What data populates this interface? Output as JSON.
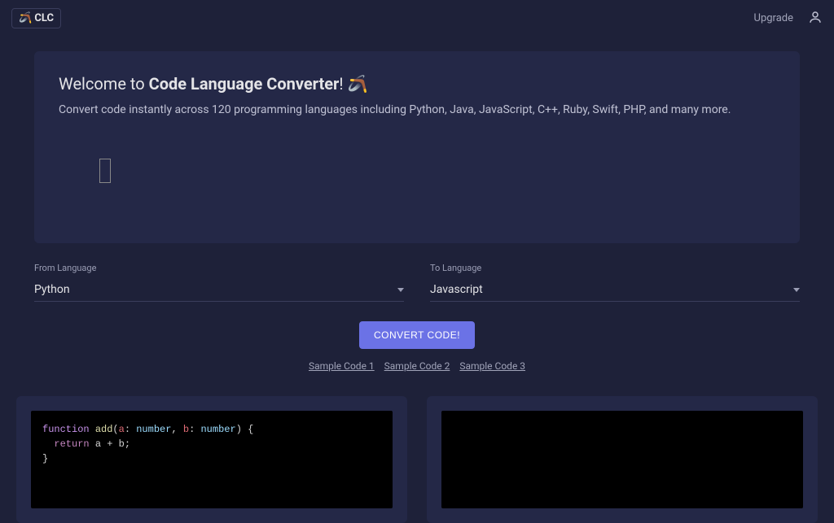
{
  "nav": {
    "logo": "🪃 CLC",
    "upgrade": "Upgrade"
  },
  "hero": {
    "welcome_prefix": "Welcome to ",
    "welcome_strong": "Code Language Converter",
    "welcome_suffix": "! 🪃",
    "subtitle": "Convert code instantly across 120 programming languages including Python, Java, JavaScript, C++, Ruby, Swift, PHP, and many more."
  },
  "selectors": {
    "from_label": "From Language",
    "from_value": "Python",
    "to_label": "To Language",
    "to_value": "Javascript"
  },
  "convert_button": "CONVERT CODE!",
  "samples": {
    "s1": "Sample Code 1",
    "s2": "Sample Code 2",
    "s3": "Sample Code 3"
  },
  "code": {
    "input": {
      "kw_function": "function",
      "fn_name": "add",
      "paren_open": "(",
      "p1": "a",
      "colon1": ": ",
      "t1": "number",
      "comma": ", ",
      "p2": "b",
      "colon2": ": ",
      "t2": "number",
      "paren_close": ")",
      "brace_open": " {",
      "kw_return": "return",
      "expr": " a + b",
      "semi": ";",
      "brace_close": "}"
    },
    "output": ""
  }
}
